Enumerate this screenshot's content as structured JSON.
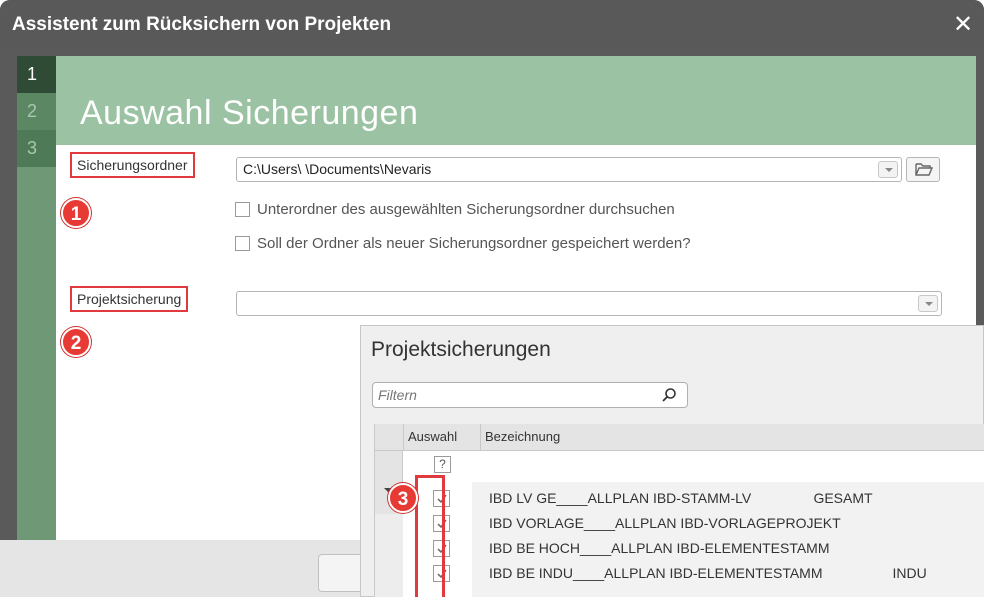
{
  "window": {
    "title": "Assistent zum Rücksichern von Projekten",
    "close_symbol": "✕"
  },
  "steps": [
    "1",
    "2",
    "3"
  ],
  "page": {
    "heading": "Auswahl Sicherungen"
  },
  "form": {
    "backup_folder_label": "Sicherungsordner",
    "backup_folder_value": "C:\\Users\\               \\Documents\\Nevaris",
    "subfolder_checkbox": "Unterordner des ausgewählten Sicherungsordner durchsuchen",
    "save_folder_checkbox": "Soll der Ordner als neuer Sicherungsordner gespeichert werden?",
    "project_backup_label": "Projektsicherung",
    "project_backup_value": ""
  },
  "badges": [
    "1",
    "2",
    "3"
  ],
  "popup": {
    "title": "Projektsicherungen",
    "filter_placeholder": "Filtern",
    "columns": [
      "Auswahl",
      "Bezeichnung"
    ],
    "filter_cell": "?",
    "rows": [
      {
        "checked": true,
        "text": "IBD LV GE____ALLPLAN IBD-STAMM-LV                GESAMT"
      },
      {
        "checked": true,
        "text": "IBD VORLAGE____ALLPLAN IBD-VORLAGEPROJEKT"
      },
      {
        "checked": true,
        "text": "IBD BE HOCH____ALLPLAN IBD-ELEMENTESTAMM"
      },
      {
        "checked": true,
        "text": "IBD BE INDU____ALLPLAN IBD-ELEMENTESTAMM                  INDU"
      }
    ]
  },
  "colors": {
    "accent_red": "#e0393e",
    "header_green": "#9bc2a3",
    "titlebar": "#595959"
  }
}
